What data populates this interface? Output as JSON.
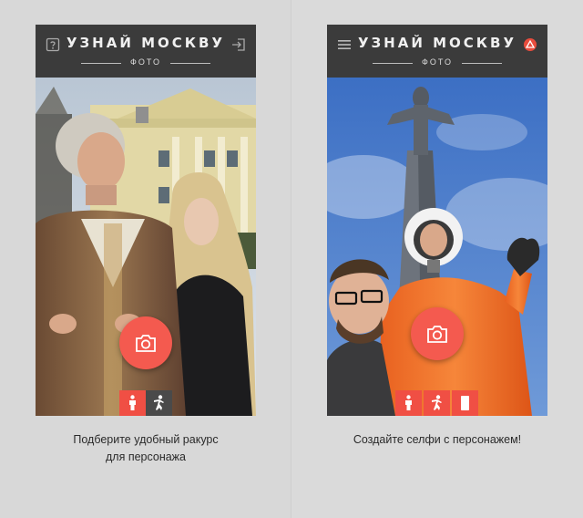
{
  "app": {
    "title": "УЗНАЙ МОСКВУ",
    "subtitle": "ФОТО"
  },
  "screens": [
    {
      "caption_line1": "Подберите удобный ракурс",
      "caption_line2": "для персонажа",
      "header_left_icon": "help-icon",
      "header_right_icon": "exit-icon",
      "tools": [
        "person-icon",
        "pose-icon"
      ]
    },
    {
      "caption_line1": "Создайте селфи с персонажем!",
      "caption_line2": "",
      "header_left_icon": "menu-icon",
      "header_right_icon": "logo-icon",
      "tools": [
        "person-icon",
        "pose-icon",
        "phone-icon"
      ]
    }
  ],
  "colors": {
    "accent": "#f45a4f",
    "appbar": "#3b3b3b",
    "background": "#d9d9d9"
  }
}
